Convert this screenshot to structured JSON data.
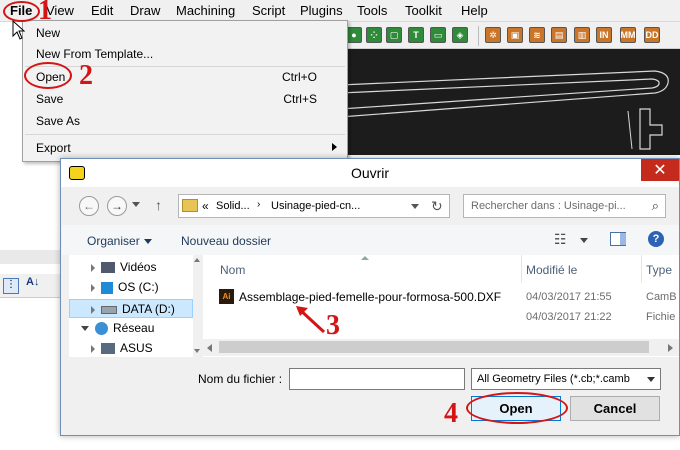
{
  "menubar": {
    "items": [
      "File",
      "View",
      "Edit",
      "Draw",
      "Machining",
      "Script",
      "Plugins",
      "Tools",
      "Toolkit",
      "Help"
    ]
  },
  "file_menu": {
    "items": [
      {
        "label": "New",
        "shortcut": ""
      },
      {
        "label": "New From Template...",
        "shortcut": ""
      },
      {
        "label": "Open",
        "shortcut": "Ctrl+O"
      },
      {
        "label": "Save",
        "shortcut": "Ctrl+S"
      },
      {
        "label": "Save As",
        "shortcut": ""
      },
      {
        "label": "Export",
        "shortcut": ""
      }
    ]
  },
  "toolbar": {
    "buttons": [
      "T",
      "W",
      "N",
      "R",
      "IN",
      "W",
      "MM",
      "DD"
    ]
  },
  "dialog": {
    "title": "Ouvrir",
    "address": {
      "prefix": "«",
      "segments": [
        "Solid...",
        "Usinage-pied-cn..."
      ]
    },
    "search_placeholder": "Rechercher dans : Usinage-pi...",
    "commands": {
      "organize": "Organiser",
      "new_folder": "Nouveau dossier"
    },
    "nav_tree": [
      {
        "label": "Vidéos"
      },
      {
        "label": "OS (C:)"
      },
      {
        "label": "DATA (D:)"
      },
      {
        "label": "Réseau"
      },
      {
        "label": "ASUS"
      }
    ],
    "columns": {
      "name": "Nom",
      "modified": "Modifié le",
      "type": "Type"
    },
    "files": [
      {
        "name": "Assemblage-pied-femelle-pour-formosa-500.DXF",
        "icon": "Ai",
        "modified": "04/03/2017 21:55",
        "type": "CamB"
      },
      {
        "name": "",
        "icon": "",
        "modified": "04/03/2017 21:22",
        "type": "Fichie"
      }
    ],
    "filename_label": "Nom du fichier :",
    "filename_value": "",
    "filetype_value": "All Geometry Files (*.cb;*.camb",
    "open_button": "Open",
    "cancel_button": "Cancel"
  },
  "annotations": [
    "1",
    "2",
    "3",
    "4"
  ],
  "colors": {
    "annotation_red": "#d31515",
    "close_red": "#c42b1c",
    "canvas_dark": "#1c1c1c",
    "nav_selected": "#cce8ff"
  }
}
